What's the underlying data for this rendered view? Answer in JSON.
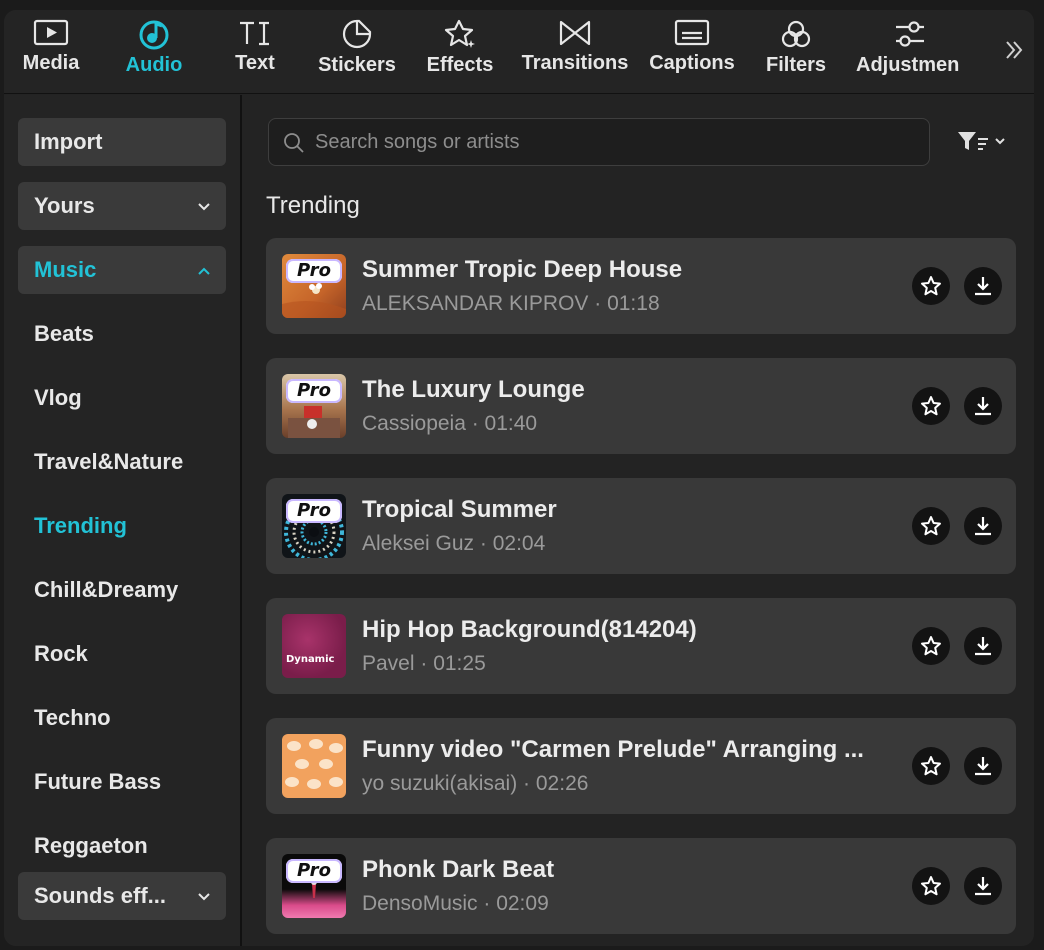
{
  "toolbar": {
    "items": [
      {
        "label": "Media",
        "icon": "media-icon"
      },
      {
        "label": "Audio",
        "icon": "audio-icon",
        "active": true
      },
      {
        "label": "Text",
        "icon": "text-icon"
      },
      {
        "label": "Stickers",
        "icon": "stickers-icon"
      },
      {
        "label": "Effects",
        "icon": "effects-icon"
      },
      {
        "label": "Transitions",
        "icon": "transitions-icon"
      },
      {
        "label": "Captions",
        "icon": "captions-icon"
      },
      {
        "label": "Filters",
        "icon": "filters-icon"
      },
      {
        "label": "Adjustmen",
        "icon": "adjustment-icon"
      }
    ],
    "more_icon": "double-chevron-right-icon"
  },
  "sidebar": {
    "import_label": "Import",
    "yours_label": "Yours",
    "music_label": "Music",
    "subcategories": [
      "Beats",
      "Vlog",
      "Travel&Nature",
      "Trending",
      "Chill&Dreamy",
      "Rock",
      "Techno",
      "Future Bass",
      "Reggaeton"
    ],
    "active_subcategory": "Trending",
    "sounds_label": "Sounds eff..."
  },
  "search": {
    "placeholder": "Search songs or artists"
  },
  "section_title": "Trending",
  "badge_label": "Pro",
  "tracks": [
    {
      "title": "Summer Tropic Deep House",
      "meta": "ALEKSANDAR KIPROV · 01:18",
      "pro": true
    },
    {
      "title": "The Luxury Lounge",
      "meta": "Cassiopeia · 01:40",
      "pro": true
    },
    {
      "title": "Tropical Summer",
      "meta": "Aleksei Guz · 02:04",
      "pro": true
    },
    {
      "title": "Hip Hop Background(814204)",
      "meta": "Pavel · 01:25",
      "pro": false,
      "thumb_text": "Dynamic"
    },
    {
      "title": "Funny video \"Carmen Prelude\" Arranging ...",
      "meta": "yo suzuki(akisai) · 02:26",
      "pro": false
    },
    {
      "title": "Phonk Dark Beat",
      "meta": "DensoMusic · 02:09",
      "pro": true
    }
  ],
  "colors": {
    "accent": "#22c2d6",
    "background": "#232323",
    "card": "#393939"
  }
}
